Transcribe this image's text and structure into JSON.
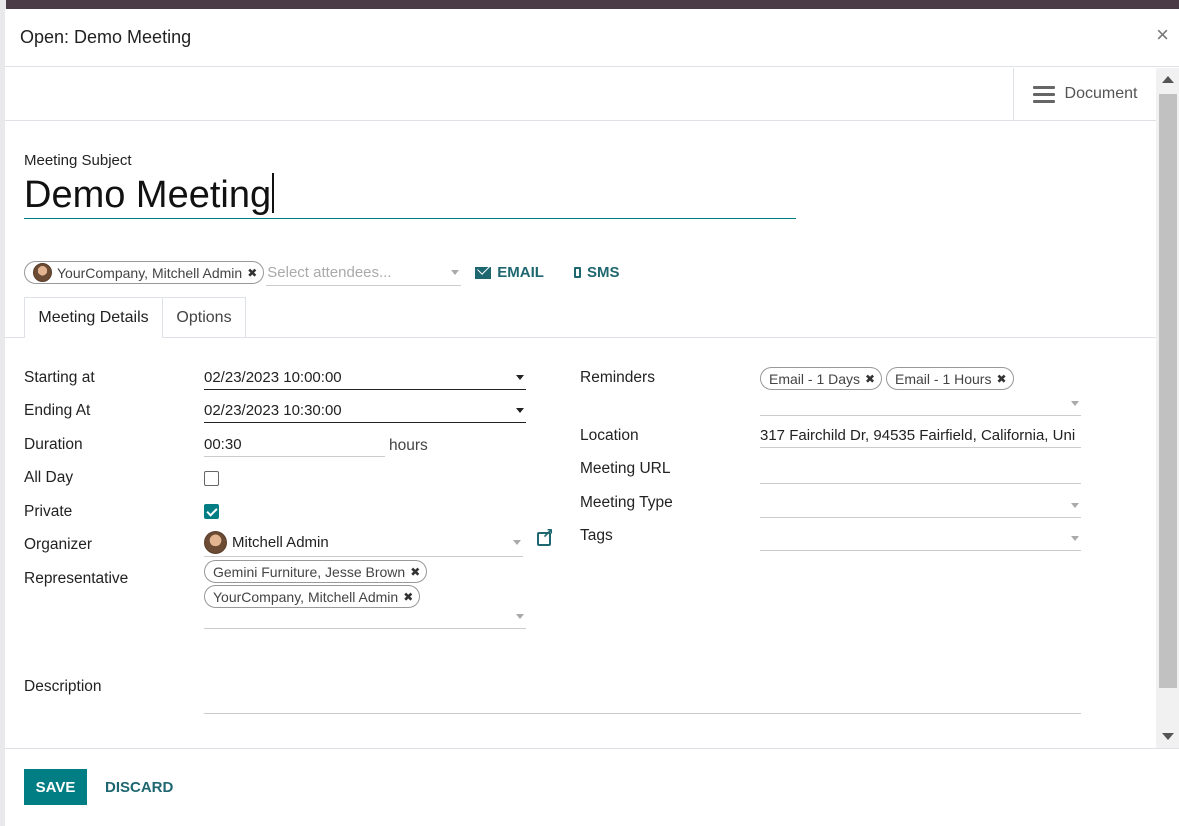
{
  "dialog": {
    "title": "Open: Demo Meeting",
    "close_glyph": "×"
  },
  "statusbar": {
    "document_label": "Document",
    "document_icon": "hamburger-icon"
  },
  "subject": {
    "label": "Meeting Subject",
    "value": "Demo Meeting"
  },
  "attendees": {
    "tags": [
      {
        "label": "YourCompany, Mitchell Admin"
      }
    ],
    "placeholder": "Select attendees...",
    "email_label": "EMAIL",
    "sms_label": "SMS"
  },
  "tabs": [
    {
      "label": "Meeting Details",
      "active": true
    },
    {
      "label": "Options",
      "active": false
    }
  ],
  "left_fields": {
    "starting_at": {
      "label": "Starting at",
      "value": "02/23/2023 10:00:00"
    },
    "ending_at": {
      "label": "Ending At",
      "value": "02/23/2023 10:30:00"
    },
    "duration": {
      "label": "Duration",
      "value": "00:30",
      "unit": "hours"
    },
    "all_day": {
      "label": "All Day",
      "checked": false
    },
    "private": {
      "label": "Private",
      "checked": true
    },
    "organizer": {
      "label": "Organizer",
      "value": "Mitchell Admin"
    },
    "representative": {
      "label": "Representative",
      "tags": [
        {
          "label": "Gemini Furniture, Jesse Brown"
        },
        {
          "label": "YourCompany, Mitchell Admin"
        }
      ]
    }
  },
  "right_fields": {
    "reminders": {
      "label": "Reminders",
      "tags": [
        {
          "label": "Email - 1 Days"
        },
        {
          "label": "Email - 1 Hours"
        }
      ]
    },
    "location": {
      "label": "Location",
      "value": "317 Fairchild Dr, 94535 Fairfield, California, Uni"
    },
    "meeting_url": {
      "label": "Meeting URL",
      "value": ""
    },
    "meeting_type": {
      "label": "Meeting Type",
      "value": ""
    },
    "tags": {
      "label": "Tags",
      "value": ""
    }
  },
  "description": {
    "label": "Description",
    "value": ""
  },
  "footer": {
    "save_label": "SAVE",
    "discard_label": "DISCARD"
  },
  "colors": {
    "primary": "#017e84",
    "link": "#1f6770"
  }
}
